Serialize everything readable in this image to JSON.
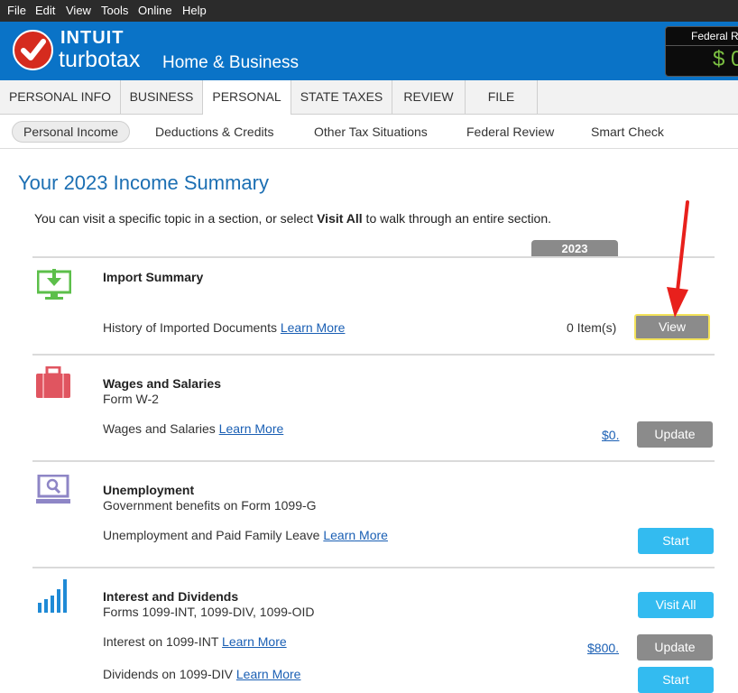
{
  "menu": [
    "File",
    "Edit",
    "View",
    "Tools",
    "Online",
    "Help"
  ],
  "brand": {
    "intuit": "INTUIT",
    "turbotax": "turbotax",
    "edition": "Home & Business"
  },
  "refund": {
    "label": "Federal R",
    "value": "$ 0"
  },
  "tabs": [
    "PERSONAL INFO",
    "BUSINESS",
    "PERSONAL",
    "STATE TAXES",
    "REVIEW",
    "FILE"
  ],
  "subnav": [
    "Personal Income",
    "Deductions & Credits",
    "Other Tax Situations",
    "Federal Review",
    "Smart Check"
  ],
  "page": {
    "title": "Your 2023 Income Summary",
    "intro_before": "You can visit a specific topic in a section, or select ",
    "intro_bold": "Visit All",
    "intro_after": " to walk through an entire section.",
    "year": "2023"
  },
  "sections": {
    "import": {
      "title": "Import Summary",
      "row_label": "History of Imported Documents",
      "learn_more": "Learn More",
      "count": "0 Item(s)",
      "button": "View"
    },
    "wages": {
      "title": "Wages and Salaries",
      "subtitle": "Form W-2",
      "row_label": "Wages and Salaries",
      "learn_more": "Learn More",
      "amount": "$0.",
      "button": "Update"
    },
    "unemployment": {
      "title": "Unemployment",
      "subtitle": "Government benefits on Form 1099-G",
      "row_label": "Unemployment and Paid Family Leave",
      "learn_more": "Learn More",
      "button": "Start"
    },
    "interest": {
      "title": "Interest and Dividends",
      "subtitle": "Forms 1099-INT, 1099-DIV, 1099-OID",
      "visit_all": "Visit All",
      "row1_label": "Interest on 1099-INT",
      "row1_learn_more": "Learn More",
      "row1_amount": "$800.",
      "row1_button": "Update",
      "row2_label": "Dividends on 1099-DIV",
      "row2_learn_more": "Learn More",
      "row2_button": "Start"
    }
  },
  "colors": {
    "brand_blue": "#0a73c7",
    "section_title": "#1c6fb3",
    "start_button": "#33bbf0",
    "gray_button": "#8b8b8b",
    "annotation_arrow": "#e8201c"
  },
  "icons": [
    "import-download-icon",
    "briefcase-icon",
    "laptop-search-icon",
    "bar-chart-icon",
    "annotation-arrow"
  ]
}
